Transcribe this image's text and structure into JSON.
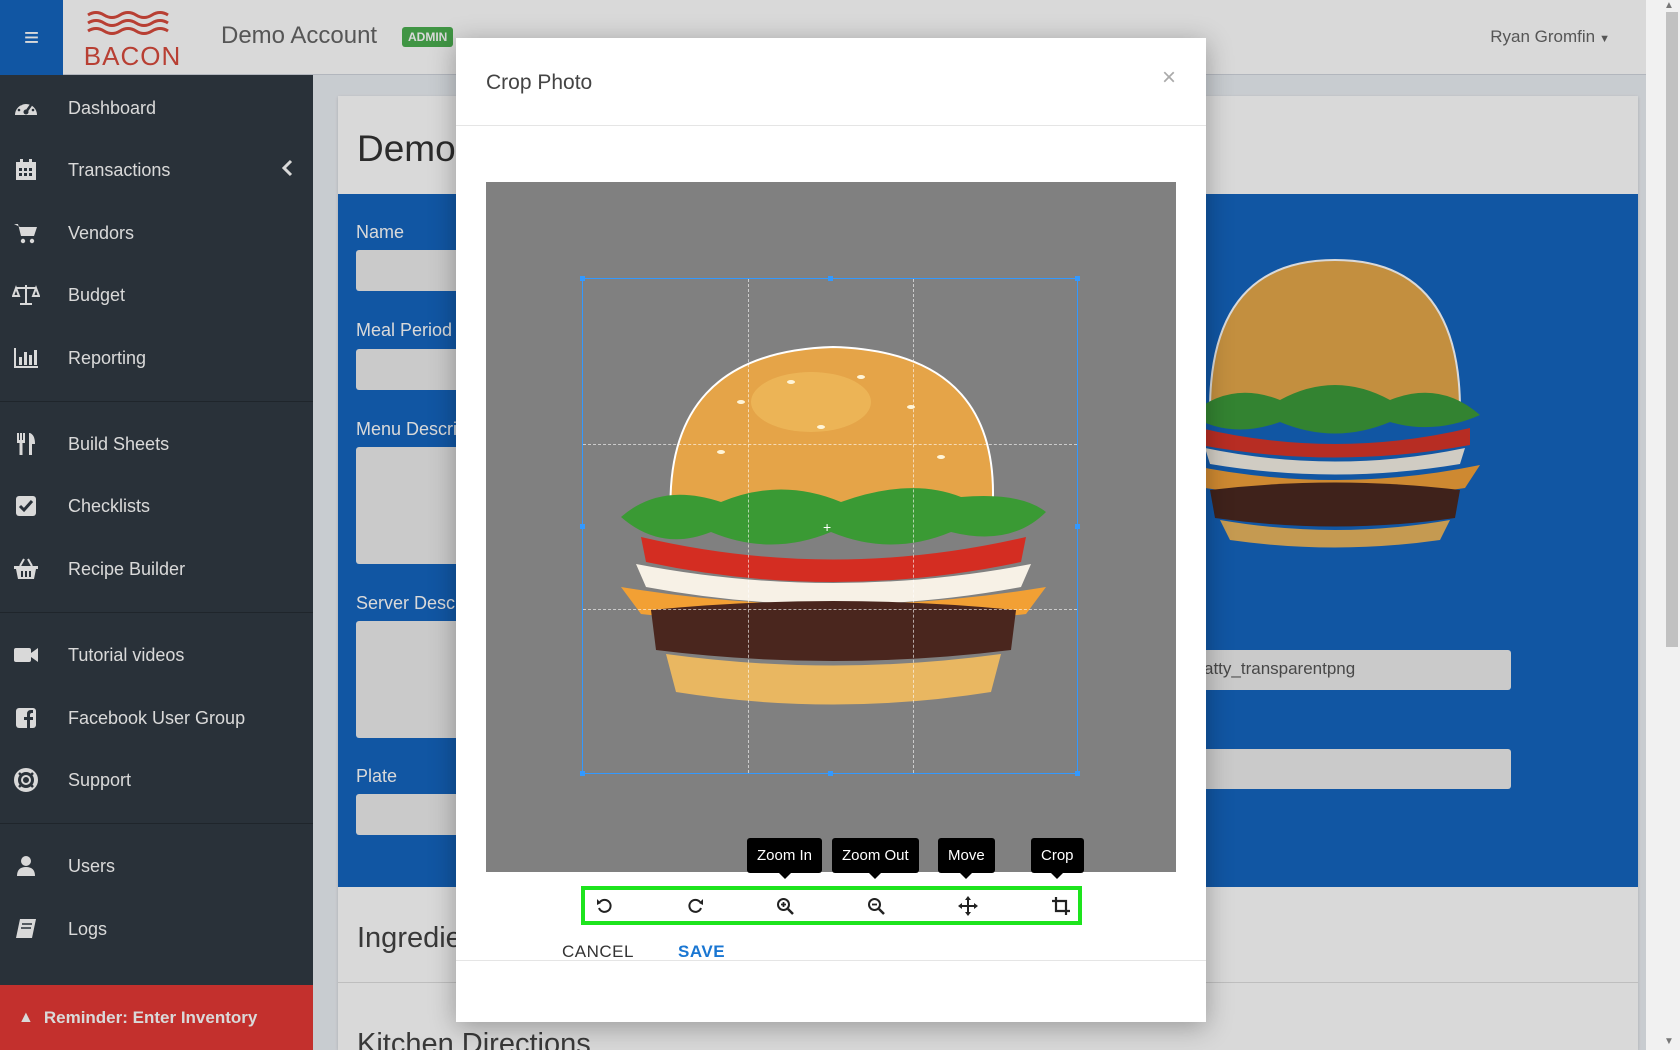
{
  "app": {
    "logo_text": "BACON",
    "account_name": "Demo Account",
    "role_badge": "ADMIN",
    "user_name": "Ryan Gromfin"
  },
  "sidebar": {
    "items": [
      {
        "label": "Dashboard",
        "icon": "dashboard-icon"
      },
      {
        "label": "Transactions",
        "icon": "calendar-icon"
      },
      {
        "label": "Vendors",
        "icon": "cart-icon"
      },
      {
        "label": "Budget",
        "icon": "scale-icon"
      },
      {
        "label": "Reporting",
        "icon": "bar-chart-icon"
      },
      {
        "label": "Build Sheets",
        "icon": "utensils-icon"
      },
      {
        "label": "Checklists",
        "icon": "checkbox-icon"
      },
      {
        "label": "Recipe Builder",
        "icon": "basket-icon"
      },
      {
        "label": "Tutorial videos",
        "icon": "video-icon"
      },
      {
        "label": "Facebook User Group",
        "icon": "facebook-icon"
      },
      {
        "label": "Support",
        "icon": "lifebuoy-icon"
      },
      {
        "label": "Users",
        "icon": "user-icon"
      },
      {
        "label": "Logs",
        "icon": "book-icon"
      }
    ],
    "reminder": "Reminder: Enter Inventory"
  },
  "background": {
    "title": "Demo",
    "fields": {
      "name": "Name",
      "meal_period": "Meal Period",
      "menu_description": "Menu Descri",
      "server_description": "Server Descr",
      "plate": "Plate"
    },
    "image_filename": "atty_transparentpng",
    "ingredients": "Ingredie",
    "kitchen": "Kitchen Directions"
  },
  "modal": {
    "title": "Crop Photo",
    "close": "×",
    "tooltips": {
      "zoom_in": "Zoom In",
      "zoom_out": "Zoom Out",
      "move": "Move",
      "crop": "Crop"
    },
    "tools": [
      "rotate-left-icon",
      "rotate-right-icon",
      "zoom-in-icon",
      "zoom-out-icon",
      "move-icon",
      "crop-icon"
    ],
    "cancel": "CANCEL",
    "save": "SAVE"
  },
  "colors": {
    "primary": "#1565c0",
    "sidebar": "#313a43",
    "reminder": "#e53935",
    "toolbar_highlight": "#1de41d",
    "admin_badge": "#4caf50"
  }
}
